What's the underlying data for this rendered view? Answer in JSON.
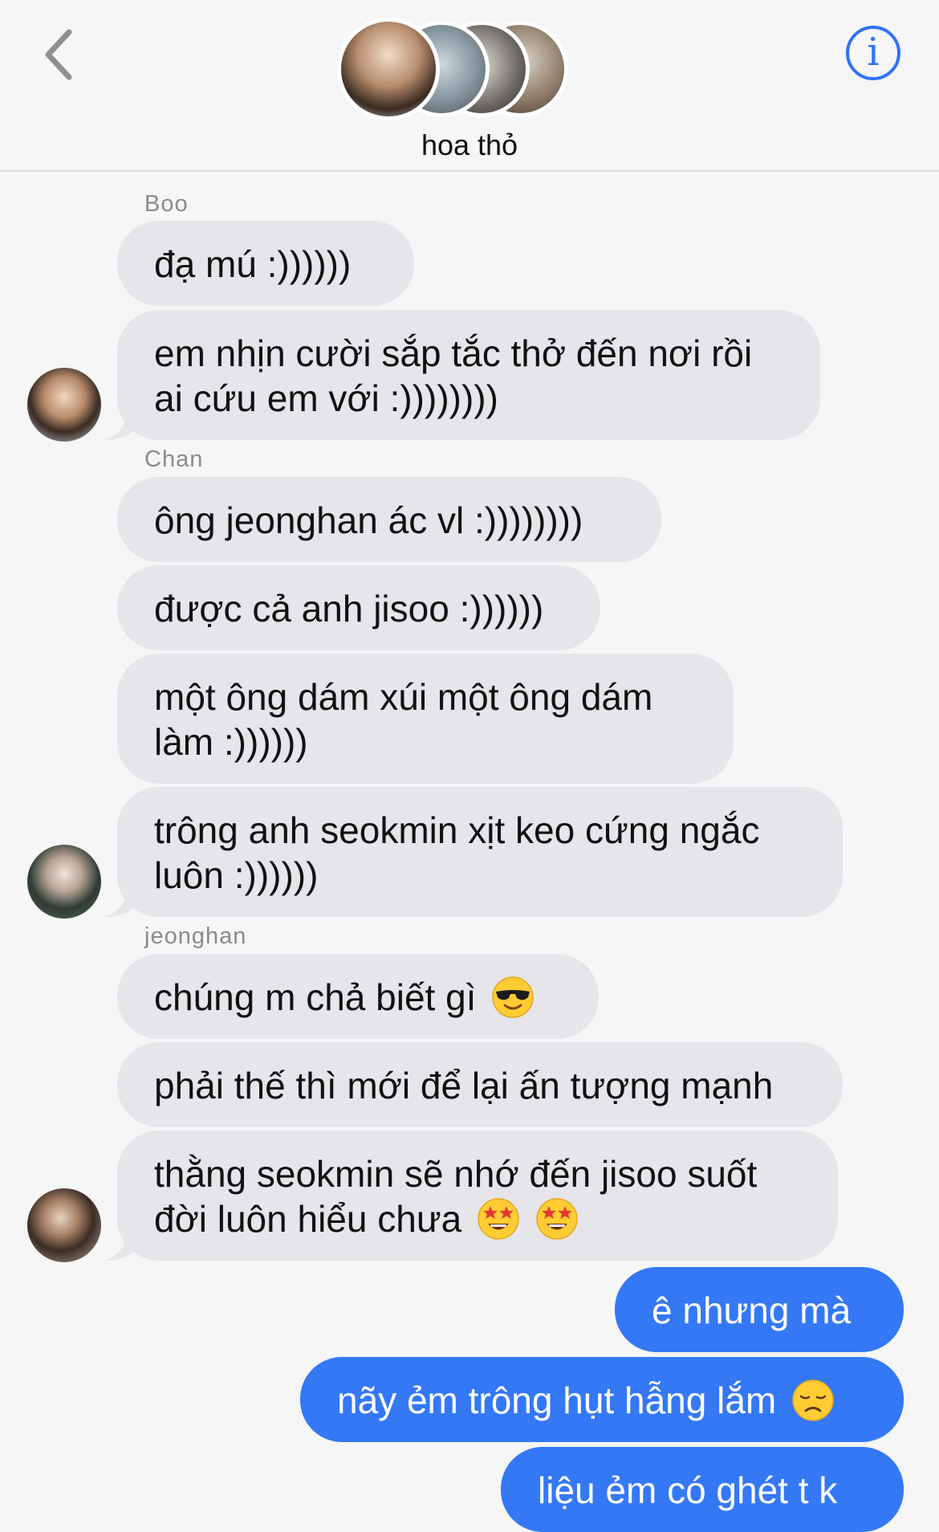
{
  "header": {
    "title": "hoa thỏ",
    "back_icon": "chevron-left-icon",
    "info_label": "i"
  },
  "messages": [
    {
      "sender": "Boo",
      "lines": [
        "đạ mú :))))))"
      ]
    },
    {
      "lines": [
        "em nhịn cười sắp tắc thở đến nơi rồi",
        "ai cứu em với :))))))))"
      ]
    },
    {
      "sender": "Chan",
      "lines": [
        "ông jeonghan ác vl :))))))))"
      ]
    },
    {
      "lines": [
        "được cả anh jisoo :))))))"
      ]
    },
    {
      "lines": [
        "một ông dám xúi một ông dám",
        "làm :))))))"
      ]
    },
    {
      "lines": [
        "trông anh seokmin xịt keo cứng ngắc",
        "luôn :))))))"
      ]
    },
    {
      "sender": "jeonghan",
      "lines": [
        "chúng m chả biết gì"
      ],
      "emoji": "smiling-face-with-sunglasses"
    },
    {
      "lines": [
        "phải thế thì mới để lại ấn tượng mạnh"
      ]
    },
    {
      "lines": [
        "thằng seokmin sẽ nhớ đến jisoo suốt",
        "đời luôn hiểu chưa"
      ],
      "emoji": "star-struck"
    },
    {
      "outgoing": true,
      "lines": [
        "ê nhưng mà"
      ]
    },
    {
      "outgoing": true,
      "lines": [
        "nãy ẻm trông hụt hẫng lắm"
      ],
      "emoji": "disappointed-face"
    },
    {
      "outgoing": true,
      "lines": [
        "liệu ẻm có ghét t k"
      ]
    }
  ],
  "colors": {
    "accent": "#3478f6",
    "incoming_bubble": "#e5e5ea",
    "background": "#f6f6f6"
  }
}
